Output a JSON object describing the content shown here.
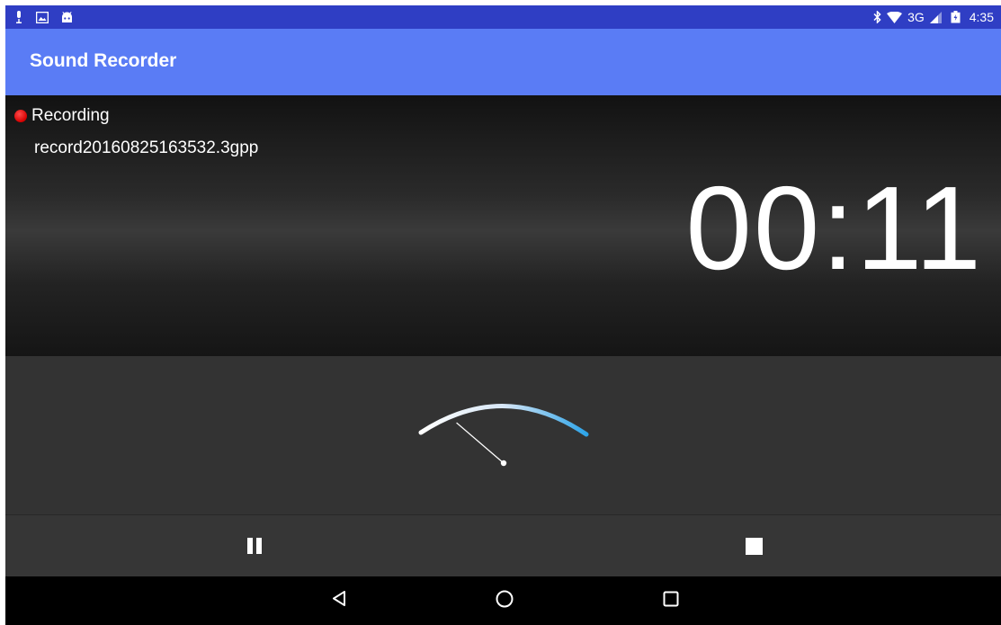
{
  "status_bar": {
    "left_icons": [
      "microphone-icon",
      "image-icon",
      "android-icon"
    ],
    "right_icons": [
      "bluetooth-icon",
      "wifi-icon",
      "signal-icon",
      "battery-icon"
    ],
    "network": "3G",
    "time": "4:35",
    "color": "#2f3ec4"
  },
  "app_bar": {
    "title": "Sound Recorder",
    "color": "#5a7cf5"
  },
  "recording": {
    "status": "Recording",
    "file_name": "record20160825163532.3gpp",
    "elapsed": "00:11",
    "indicator_color": "#d40000"
  },
  "meter": {
    "level": 0.12,
    "arc_start_color": "#ffffff",
    "arc_end_color": "#2aa3e8"
  },
  "controls": {
    "buttons": [
      "pause-icon",
      "stop-icon"
    ]
  },
  "nav_bar": {
    "buttons": [
      "back-icon",
      "home-icon",
      "recents-icon"
    ]
  }
}
